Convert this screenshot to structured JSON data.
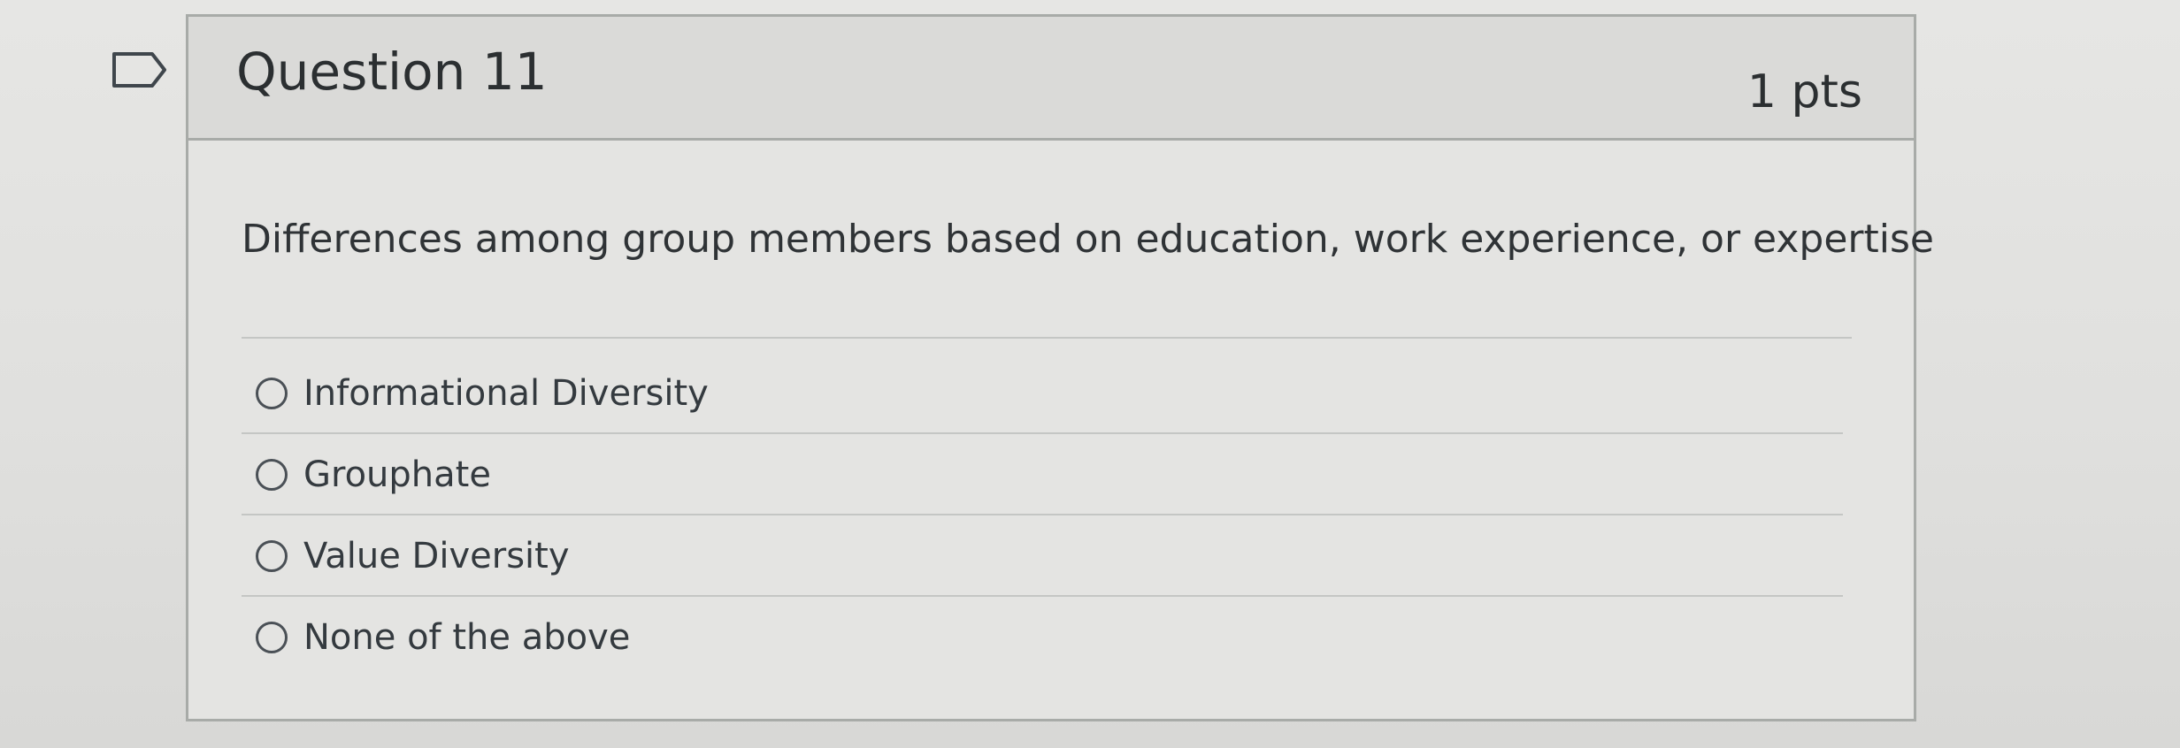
{
  "question": {
    "title": "Question 11",
    "points": "1 pts",
    "text": "Differences among group members based on education, work experience, or expertise"
  },
  "icons": {
    "flag": "flag-question-icon",
    "radio": "radio-button-icon"
  },
  "answers": [
    {
      "label": "Informational Diversity"
    },
    {
      "label": "Grouphate"
    },
    {
      "label": "Value Diversity"
    },
    {
      "label": "None of the above"
    }
  ]
}
